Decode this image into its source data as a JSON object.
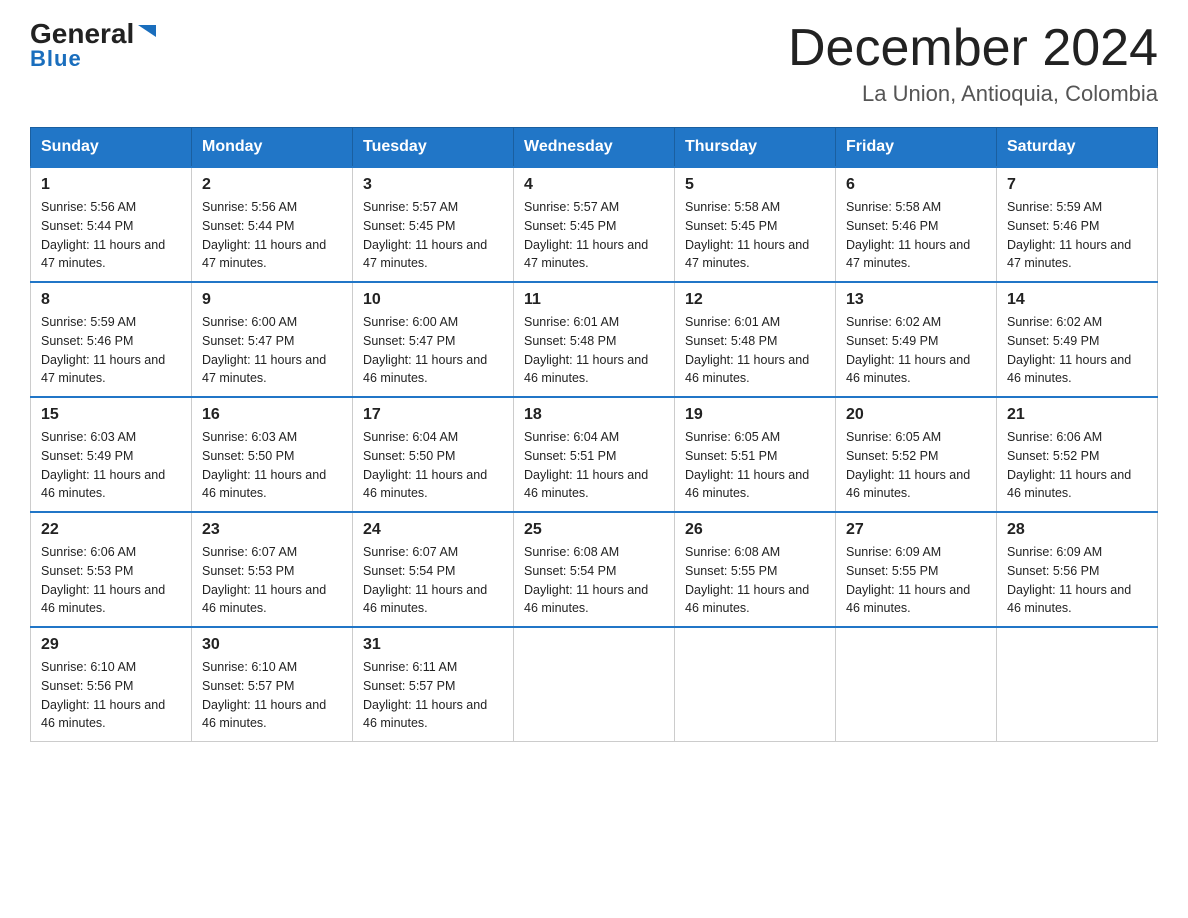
{
  "logo": {
    "general": "General",
    "arrow": "▶",
    "blue": "Blue"
  },
  "title": {
    "month_year": "December 2024",
    "location": "La Union, Antioquia, Colombia"
  },
  "weekdays": [
    "Sunday",
    "Monday",
    "Tuesday",
    "Wednesday",
    "Thursday",
    "Friday",
    "Saturday"
  ],
  "weeks": [
    [
      {
        "day": "1",
        "sunrise": "5:56 AM",
        "sunset": "5:44 PM",
        "daylight": "11 hours and 47 minutes."
      },
      {
        "day": "2",
        "sunrise": "5:56 AM",
        "sunset": "5:44 PM",
        "daylight": "11 hours and 47 minutes."
      },
      {
        "day": "3",
        "sunrise": "5:57 AM",
        "sunset": "5:45 PM",
        "daylight": "11 hours and 47 minutes."
      },
      {
        "day": "4",
        "sunrise": "5:57 AM",
        "sunset": "5:45 PM",
        "daylight": "11 hours and 47 minutes."
      },
      {
        "day": "5",
        "sunrise": "5:58 AM",
        "sunset": "5:45 PM",
        "daylight": "11 hours and 47 minutes."
      },
      {
        "day": "6",
        "sunrise": "5:58 AM",
        "sunset": "5:46 PM",
        "daylight": "11 hours and 47 minutes."
      },
      {
        "day": "7",
        "sunrise": "5:59 AM",
        "sunset": "5:46 PM",
        "daylight": "11 hours and 47 minutes."
      }
    ],
    [
      {
        "day": "8",
        "sunrise": "5:59 AM",
        "sunset": "5:46 PM",
        "daylight": "11 hours and 47 minutes."
      },
      {
        "day": "9",
        "sunrise": "6:00 AM",
        "sunset": "5:47 PM",
        "daylight": "11 hours and 47 minutes."
      },
      {
        "day": "10",
        "sunrise": "6:00 AM",
        "sunset": "5:47 PM",
        "daylight": "11 hours and 46 minutes."
      },
      {
        "day": "11",
        "sunrise": "6:01 AM",
        "sunset": "5:48 PM",
        "daylight": "11 hours and 46 minutes."
      },
      {
        "day": "12",
        "sunrise": "6:01 AM",
        "sunset": "5:48 PM",
        "daylight": "11 hours and 46 minutes."
      },
      {
        "day": "13",
        "sunrise": "6:02 AM",
        "sunset": "5:49 PM",
        "daylight": "11 hours and 46 minutes."
      },
      {
        "day": "14",
        "sunrise": "6:02 AM",
        "sunset": "5:49 PM",
        "daylight": "11 hours and 46 minutes."
      }
    ],
    [
      {
        "day": "15",
        "sunrise": "6:03 AM",
        "sunset": "5:49 PM",
        "daylight": "11 hours and 46 minutes."
      },
      {
        "day": "16",
        "sunrise": "6:03 AM",
        "sunset": "5:50 PM",
        "daylight": "11 hours and 46 minutes."
      },
      {
        "day": "17",
        "sunrise": "6:04 AM",
        "sunset": "5:50 PM",
        "daylight": "11 hours and 46 minutes."
      },
      {
        "day": "18",
        "sunrise": "6:04 AM",
        "sunset": "5:51 PM",
        "daylight": "11 hours and 46 minutes."
      },
      {
        "day": "19",
        "sunrise": "6:05 AM",
        "sunset": "5:51 PM",
        "daylight": "11 hours and 46 minutes."
      },
      {
        "day": "20",
        "sunrise": "6:05 AM",
        "sunset": "5:52 PM",
        "daylight": "11 hours and 46 minutes."
      },
      {
        "day": "21",
        "sunrise": "6:06 AM",
        "sunset": "5:52 PM",
        "daylight": "11 hours and 46 minutes."
      }
    ],
    [
      {
        "day": "22",
        "sunrise": "6:06 AM",
        "sunset": "5:53 PM",
        "daylight": "11 hours and 46 minutes."
      },
      {
        "day": "23",
        "sunrise": "6:07 AM",
        "sunset": "5:53 PM",
        "daylight": "11 hours and 46 minutes."
      },
      {
        "day": "24",
        "sunrise": "6:07 AM",
        "sunset": "5:54 PM",
        "daylight": "11 hours and 46 minutes."
      },
      {
        "day": "25",
        "sunrise": "6:08 AM",
        "sunset": "5:54 PM",
        "daylight": "11 hours and 46 minutes."
      },
      {
        "day": "26",
        "sunrise": "6:08 AM",
        "sunset": "5:55 PM",
        "daylight": "11 hours and 46 minutes."
      },
      {
        "day": "27",
        "sunrise": "6:09 AM",
        "sunset": "5:55 PM",
        "daylight": "11 hours and 46 minutes."
      },
      {
        "day": "28",
        "sunrise": "6:09 AM",
        "sunset": "5:56 PM",
        "daylight": "11 hours and 46 minutes."
      }
    ],
    [
      {
        "day": "29",
        "sunrise": "6:10 AM",
        "sunset": "5:56 PM",
        "daylight": "11 hours and 46 minutes."
      },
      {
        "day": "30",
        "sunrise": "6:10 AM",
        "sunset": "5:57 PM",
        "daylight": "11 hours and 46 minutes."
      },
      {
        "day": "31",
        "sunrise": "6:11 AM",
        "sunset": "5:57 PM",
        "daylight": "11 hours and 46 minutes."
      },
      null,
      null,
      null,
      null
    ]
  ]
}
